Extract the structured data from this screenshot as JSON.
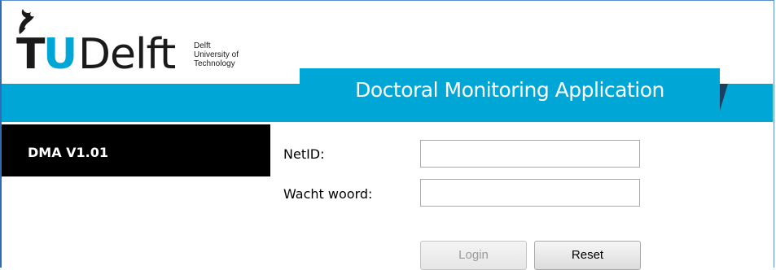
{
  "brand": {
    "logo_t": "T",
    "logo_u": "U",
    "logo_delft": "Delft",
    "logo_small_lines": [
      "Delft",
      "University of",
      "Technology"
    ]
  },
  "header": {
    "title": "Doctoral Monitoring Application"
  },
  "sidebar": {
    "version": "DMA V1.01"
  },
  "form": {
    "netid_label": "NetID:",
    "netid_value": "",
    "password_label": "Wacht woord:",
    "password_value": "",
    "login_label": "Login",
    "reset_label": "Reset"
  },
  "colors": {
    "accent": "#00a6d6",
    "panel": "#000000",
    "frame": "#2e6db4"
  }
}
